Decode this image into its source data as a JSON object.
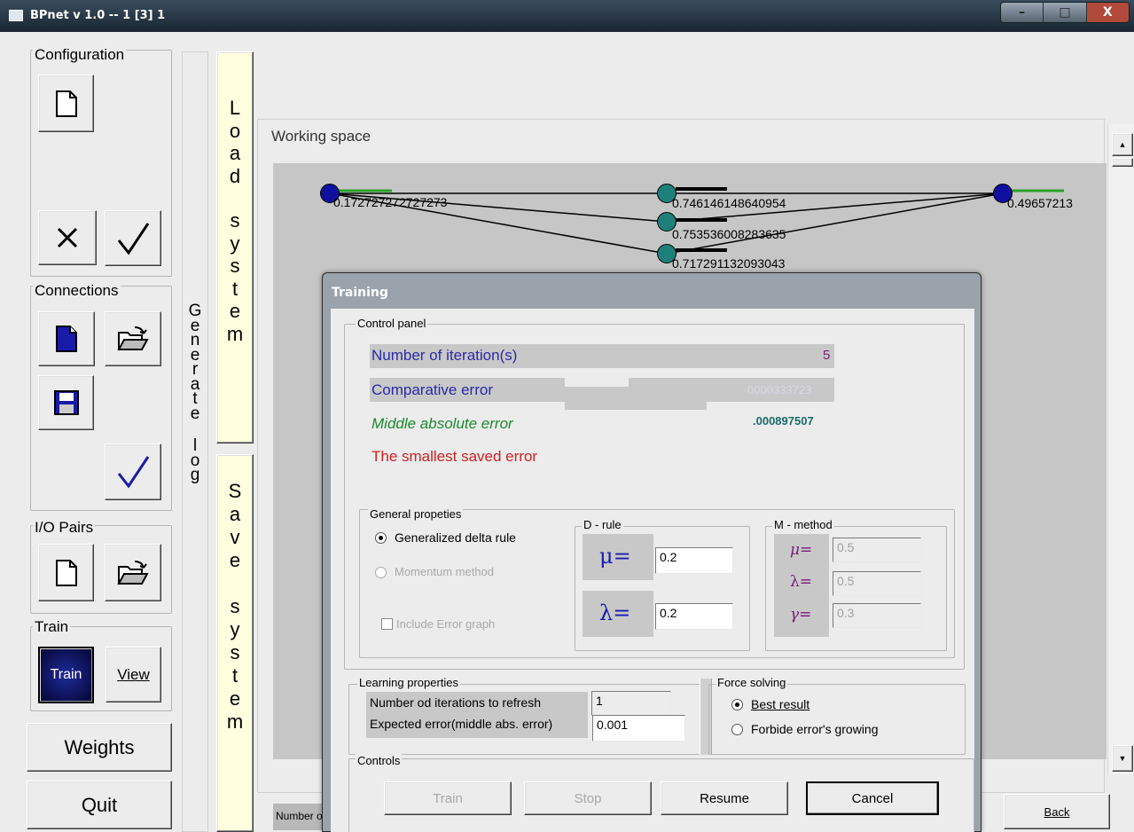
{
  "window": {
    "title": "BPnet v 1.0  --  1 [3] 1",
    "controls": [
      "–",
      "□",
      "X"
    ]
  },
  "sidebar": {
    "configuration": "Configuration",
    "connections": "Connections",
    "io_pairs": "I/O Pairs",
    "train_group": "Train",
    "train_button": "Train",
    "view_button": "View",
    "weights_button": "Weights",
    "quit_button": "Quit"
  },
  "vertical": {
    "generate_log": [
      "G",
      "e",
      "n",
      "e",
      "r",
      "a",
      "t",
      "e",
      "",
      "l",
      "o",
      "g"
    ],
    "load_system": [
      "L",
      "o",
      "a",
      "d",
      "",
      "s",
      "y",
      "s",
      "t",
      "e",
      "m"
    ],
    "save_system": [
      "S",
      "a",
      "v",
      "e",
      "",
      "s",
      "y",
      "s",
      "t",
      "e",
      "m"
    ]
  },
  "workspace": {
    "label": "Working space",
    "nodes": [
      {
        "value": "0.172727272727273",
        "color": "#1010a0"
      },
      {
        "value": "0.746146148640954",
        "color": "#1f7f7a"
      },
      {
        "value": "0.753536008283635",
        "color": "#1f7f7a"
      },
      {
        "value": "0.717291132093043",
        "color": "#1f7f7a"
      },
      {
        "value": "0.49657213",
        "color": "#1010a0"
      }
    ],
    "status_text": "Number o",
    "back_button": "Back"
  },
  "dialog": {
    "title": "Training",
    "control_panel": {
      "label": "Control panel",
      "iterations_label": "Number of iteration(s)",
      "iterations_value": "5",
      "comparative_label": "Comparative error",
      "comparative_value": "0000333723",
      "middle_label": "Middle absolute error",
      "middle_value": ".000897507",
      "smallest_label": "The smallest saved error"
    },
    "general": {
      "label": "General propeties",
      "radio1": "Generalized delta rule",
      "radio2": "Momentum method",
      "checkbox": "Include Error graph"
    },
    "d_rule": {
      "label": "D - rule",
      "mu_symbol": "μ=",
      "mu_value": "0.2",
      "lambda_symbol": "λ=",
      "lambda_value": "0.2"
    },
    "m_method": {
      "label": "M - method",
      "mu_symbol": "μ=",
      "mu_value": "0.5",
      "lambda_symbol": "λ=",
      "lambda_value": "0.5",
      "gamma_symbol": "γ=",
      "gamma_value": "0.3"
    },
    "learning": {
      "label": "Learning properties",
      "refresh_label": "Number od iterations to refresh",
      "refresh_value": "1",
      "expected_label": "Expected error(middle abs. error)",
      "expected_value": "0.001"
    },
    "force": {
      "label": "Force solving",
      "best": "Best result",
      "forbide": "Forbide error's growing"
    },
    "controls": {
      "label": "Controls",
      "train": "Train",
      "stop": "Stop",
      "resume": "Resume",
      "cancel": "Cancel"
    }
  }
}
